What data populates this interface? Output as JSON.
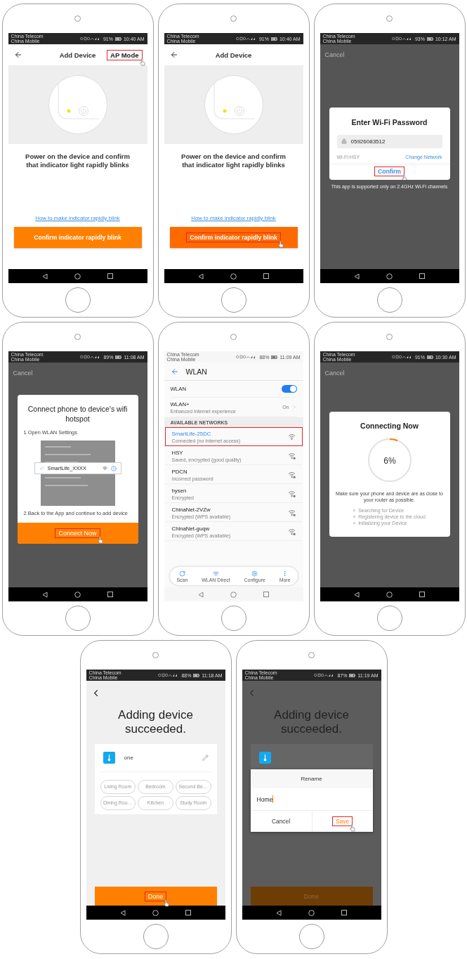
{
  "phones": [
    {
      "kind": "add_device",
      "status": {
        "carriers": [
          "China Telecom",
          "China Mobile"
        ],
        "battery": "91%",
        "time": "10:40 AM"
      },
      "title": "Add Device",
      "action": {
        "label": "AP Mode",
        "highlighted": true
      },
      "instruction": "Power on the device and confirm that indicator light rapidly blinks",
      "link": "How to make indicator rapidly blink",
      "button": {
        "label": "Confirm indicator rapidly blink",
        "highlighted": false
      }
    },
    {
      "kind": "add_device",
      "status": {
        "carriers": [
          "China Telecom",
          "China Mobile"
        ],
        "battery": "91%",
        "time": "10:40 AM"
      },
      "title": "Add Device",
      "instruction": "Power on the device and confirm that indicator light rapidly blinks",
      "link": "How to make indicator rapidly blink",
      "button": {
        "label": "Confirm indicator rapidly blink",
        "highlighted": true
      }
    },
    {
      "kind": "password",
      "status": {
        "carriers": [
          "China Telecom",
          "China Mobile"
        ],
        "battery": "93%",
        "time": "10:12 AM"
      },
      "cancel": "Cancel",
      "dialog": {
        "title": "Enter Wi-Fi Password",
        "password": "05926083512",
        "wifi": "Wi-Fi:HSY",
        "change": "Change Network",
        "confirm": {
          "label": "Confirm",
          "highlighted": true
        }
      },
      "note": "This app is supported only on 2.4GHz Wi-Fi channels"
    },
    {
      "kind": "hotspot",
      "status": {
        "carriers": [
          "China Telecom",
          "China Mobile"
        ],
        "battery": "89%",
        "time": "11:08 AM"
      },
      "cancel": "Cancel",
      "dialog": {
        "title": "Connect phone to device's wifi hotspot",
        "step1": "1.Open WLAN Settings",
        "sample": "SmartLife_XXXX",
        "step2": "2.Back to the App and continue to add device",
        "button": {
          "label": "Connect Now",
          "highlighted": true
        }
      }
    },
    {
      "kind": "wlan",
      "status": {
        "carriers": [
          "China Telecom",
          "China Mobile"
        ],
        "battery": "88%",
        "time": "11:09 AM"
      },
      "title": "WLAN",
      "toggle": {
        "label": "WLAN",
        "on": true
      },
      "plus": {
        "label": "WLAN+",
        "sub": "Enhanced Internet experience",
        "value": "On"
      },
      "section": "AVAILABLE NETWORKS",
      "networks": [
        {
          "name": "SmartLife-25DC",
          "sub": "Connected (no Internet access)",
          "locked": false,
          "selected": true
        },
        {
          "name": "HSY",
          "sub": "Saved, encrypted (good quality)",
          "locked": true,
          "selected": false
        },
        {
          "name": "PDCN",
          "sub": "Incorrect password",
          "locked": true,
          "selected": false
        },
        {
          "name": "hysen",
          "sub": "Encrypted",
          "locked": true,
          "selected": false
        },
        {
          "name": "ChinaNet-2VZw",
          "sub": "Encrypted (WPS available)",
          "locked": true,
          "selected": false
        },
        {
          "name": "ChinaNet-guqw",
          "sub": "Encrypted (WPS available)",
          "locked": true,
          "selected": false
        }
      ],
      "toolbar": [
        "Scan",
        "WLAN Direct",
        "Configure",
        "More"
      ]
    },
    {
      "kind": "connecting",
      "status": {
        "carriers": [
          "China Telecom",
          "China Mobile"
        ],
        "battery": "91%",
        "time": "10:30 AM"
      },
      "cancel": "Cancel",
      "dialog": {
        "title": "Connecting Now",
        "progress": {
          "level": 0.06,
          "label": "6%"
        },
        "note": "Make sure your phone and device are as close to your router as possible.",
        "steps": [
          "Searching for Device",
          "Registering device to the cloud",
          "Initializing your Device"
        ]
      }
    },
    {
      "kind": "success",
      "status": {
        "carriers": [
          "China Telecom",
          "China Mobile"
        ],
        "battery": "88%",
        "time": "11:18 AM"
      },
      "title": "Adding device succeeded.",
      "device": "one",
      "rooms": [
        "Living Room",
        "Bedroom",
        "Second Be…",
        "Dining Roo…",
        "Kitchen",
        "Study Room"
      ],
      "button": {
        "label": "Done",
        "highlighted": true
      }
    },
    {
      "kind": "rename",
      "status": {
        "carriers": [
          "China Telecom",
          "China Mobile"
        ],
        "battery": "87%",
        "time": "11:19 AM"
      },
      "title": "Adding device succeeded.",
      "dialog": {
        "title": "Rename",
        "value": "Home",
        "cancel": "Cancel",
        "save": {
          "label": "Save",
          "highlighted": true
        }
      },
      "button": {
        "label": "Done"
      }
    }
  ]
}
